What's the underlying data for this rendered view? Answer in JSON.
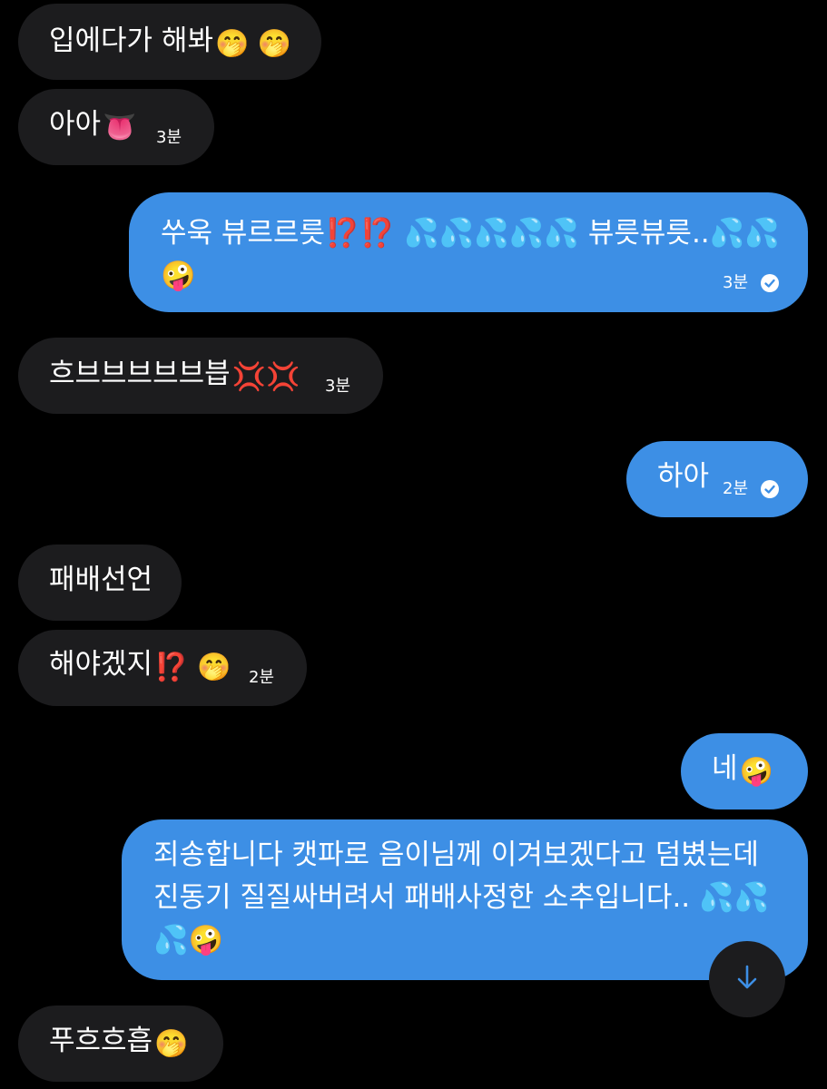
{
  "messages": [
    {
      "direction": "incoming",
      "text": "입에다가 해봐",
      "emoji": "🤭 🤭",
      "time": ""
    },
    {
      "direction": "incoming",
      "text": "아아",
      "emoji": "👅",
      "time": "3분"
    },
    {
      "direction": "outgoing",
      "text": "쑤욱 뷰르르릇⁉️⁉️ 💦💦💦💦💦 뷰릇뷰릇..💦💦🤪",
      "time": "3분",
      "read": true
    },
    {
      "direction": "incoming",
      "text": "흐브브브브브븝",
      "emoji": "💢💢",
      "time": "3분"
    },
    {
      "direction": "outgoing",
      "text": "하아",
      "time": "2분",
      "read": true
    },
    {
      "direction": "incoming",
      "text": "패배선언",
      "time": ""
    },
    {
      "direction": "incoming",
      "text": "해야겠지",
      "emoji": "⁉️ 🤭",
      "time": "2분"
    },
    {
      "direction": "outgoing",
      "text": "네",
      "emoji": "🤪",
      "time": ""
    },
    {
      "direction": "outgoing",
      "text": "죄송합니다 캣파로 음이님께 이겨보겠다고 덤볐는데 진동기 질질싸버려서 패배사정한 소추입니다.. 💦💦💦🤪",
      "time": "",
      "read": true
    },
    {
      "direction": "incoming",
      "text": "푸흐흐흡",
      "emoji": "🤭",
      "time": ""
    }
  ],
  "colors": {
    "background": "#000000",
    "incoming_bubble": "#1c1c1e",
    "outgoing_bubble": "#3d8fe5",
    "text": "#ffffff"
  },
  "scroll_button": {
    "icon": "arrow-down-icon"
  }
}
